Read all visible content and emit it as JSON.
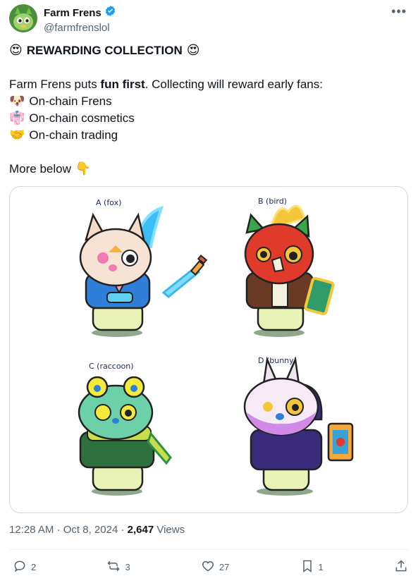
{
  "author": {
    "name": "Farm Frens",
    "handle": "@farmfrenslol",
    "verified": true
  },
  "post": {
    "title": "REWARDING COLLECTION",
    "intro_pre": "Farm Frens puts ",
    "intro_bold": "fun first",
    "intro_post": ". Collecting will reward early fans:",
    "items": [
      "On-chain Frens",
      "On-chain cosmetics",
      "On-chain trading"
    ],
    "more": "More below"
  },
  "media": {
    "labels": [
      "A (fox)",
      "B (bird)",
      "C (raccoon)",
      "D (bunny)"
    ]
  },
  "meta": {
    "time": "12:28 AM",
    "separator": "·",
    "date": "Oct 8, 2024",
    "views_count": "2,647",
    "views_label": "Views"
  },
  "actions": {
    "replies": "2",
    "reposts": "3",
    "likes": "27",
    "bookmarks": "1"
  },
  "colors": {
    "verified": "#1d9bf0",
    "secondary_text": "#536471"
  },
  "icons": {
    "heart_eyes": "heart-eyes-emoji",
    "dog": "dog-face-emoji",
    "kimono": "kimono-emoji",
    "handshake": "handshake-emoji",
    "point_down": "backhand-index-pointing-down-emoji"
  }
}
